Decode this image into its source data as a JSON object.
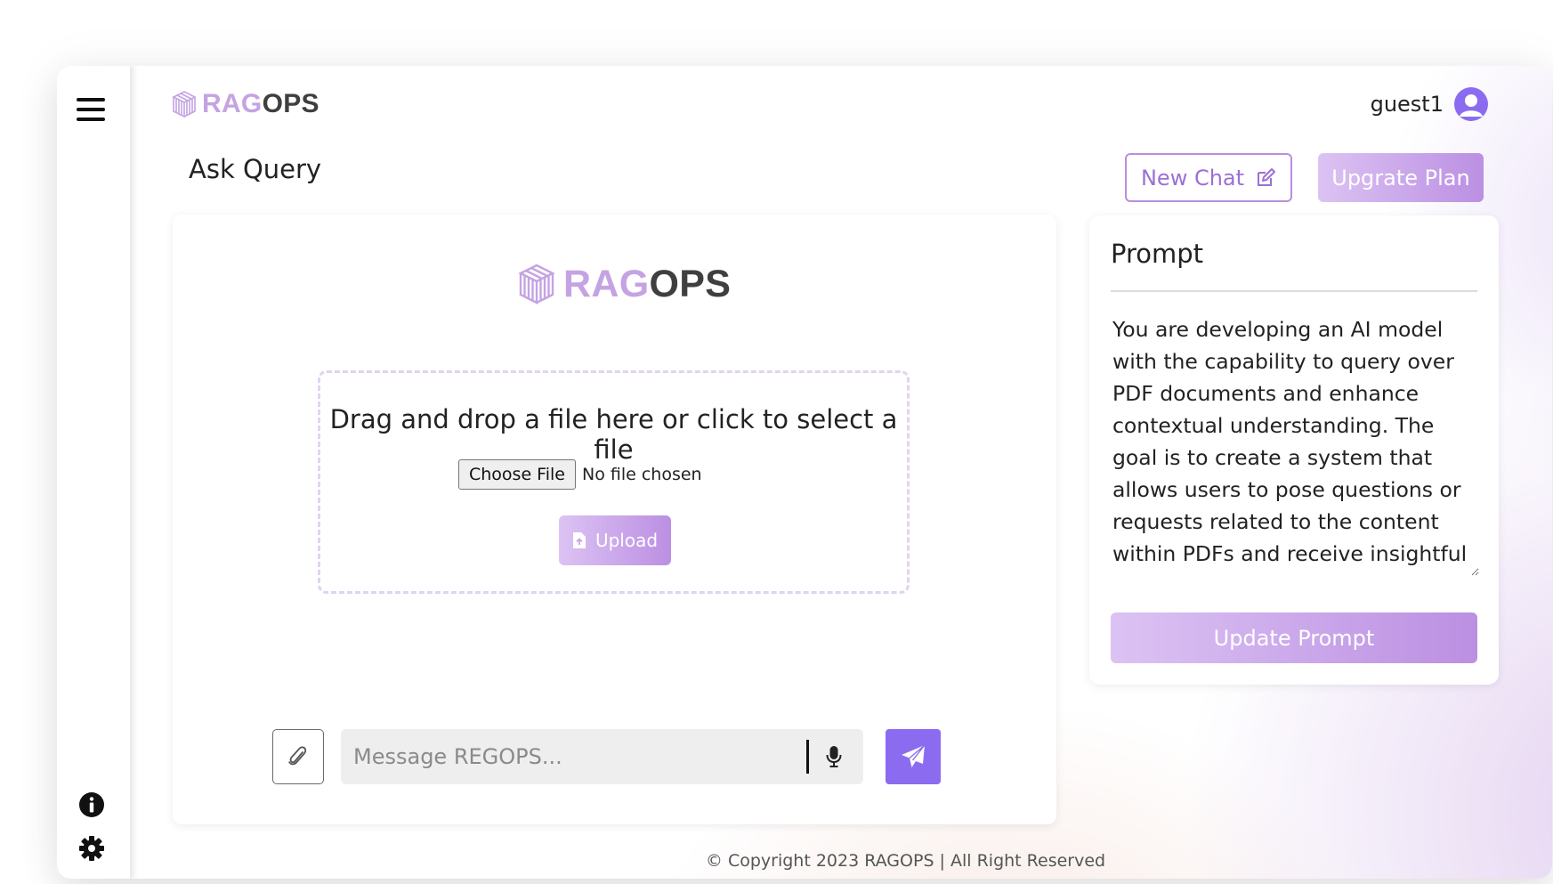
{
  "brand": {
    "rag": "RAG",
    "ops": "OPS",
    "accent": "#c5a3e3",
    "primary": "#8b6cf0"
  },
  "sidebar": {
    "menu_icon": "hamburger-menu-icon",
    "info_icon": "info-icon",
    "settings_icon": "gear-icon"
  },
  "header": {
    "username": "guest1",
    "avatar_icon": "user-circle-icon"
  },
  "page": {
    "title": "Ask Query"
  },
  "actions": {
    "new_chat": "New Chat",
    "new_chat_icon": "edit-icon",
    "upgrade": "Upgrate Plan"
  },
  "upload": {
    "instruction": "Drag and drop a file here or click to select a file",
    "choose_file": "Choose File",
    "no_file": "No file chosen",
    "button": "Upload",
    "button_icon": "file-upload-icon"
  },
  "composer": {
    "placeholder": "Message REGOPS...",
    "attach_icon": "paperclip-icon",
    "mic_icon": "microphone-icon",
    "send_icon": "paper-plane-icon"
  },
  "prompt": {
    "title": "Prompt",
    "text": "You are developing an AI model with the capability to query over PDF documents and enhance contextual understanding. The goal is to create a system that allows users to pose questions or requests related to the content within PDFs and receive insightful and contextually rich responses.",
    "button": "Update Prompt"
  },
  "footer": {
    "copyright": "© Copyright 2023 RAGOPS | All Right Reserved"
  }
}
